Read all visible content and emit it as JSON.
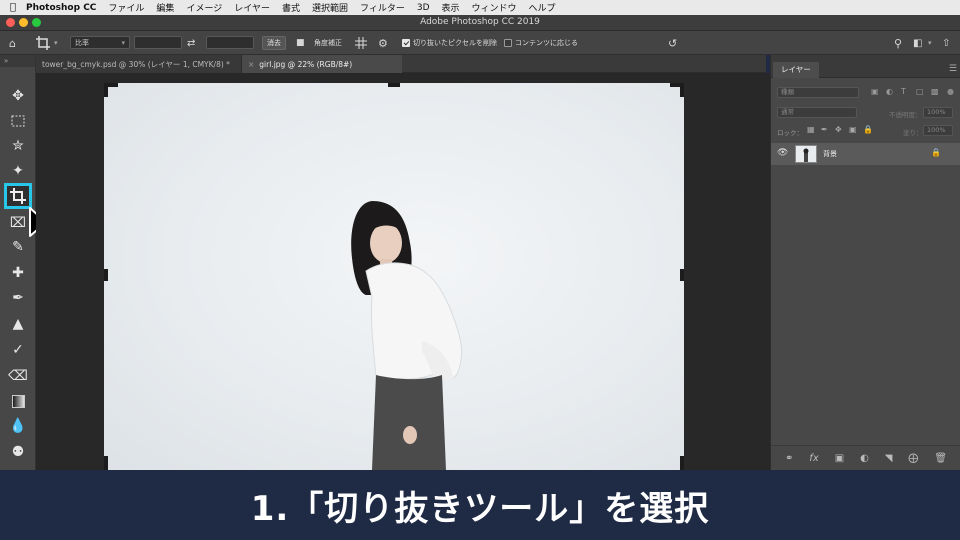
{
  "menubar": {
    "app": "Photoshop CC",
    "items": [
      "ファイル",
      "編集",
      "イメージ",
      "レイヤー",
      "書式",
      "選択範囲",
      "フィルター",
      "3D",
      "表示",
      "ウィンドウ",
      "ヘルプ"
    ]
  },
  "window": {
    "title": "Adobe Photoshop CC 2019"
  },
  "options": {
    "ratio": "比率",
    "clear": "消去",
    "straighten": "角度補正",
    "delete_cropped": "切り抜いたピクセルを削除",
    "delete_cropped_checked": true,
    "content_aware": "コンテンツに応じる",
    "content_aware_checked": false
  },
  "tabs": [
    {
      "label": "tower_bg_cmyk.psd @ 30% (レイヤー 1, CMYK/8) *",
      "active": false
    },
    {
      "label": "girl.jpg @ 22% (RGB/8#)",
      "active": true
    }
  ],
  "tools": [
    {
      "name": "move",
      "icon": "move-icon"
    },
    {
      "name": "marquee",
      "icon": "marquee-icon"
    },
    {
      "name": "lasso",
      "icon": "lasso-icon"
    },
    {
      "name": "magic-wand",
      "icon": "magic-wand-icon"
    },
    {
      "name": "crop",
      "icon": "crop-icon",
      "selected": true
    },
    {
      "name": "frame",
      "icon": "frame-icon"
    },
    {
      "name": "eyedropper",
      "icon": "eyedropper-icon"
    },
    {
      "name": "healing",
      "icon": "healing-icon"
    },
    {
      "name": "brush",
      "icon": "brush-icon"
    },
    {
      "name": "stamp",
      "icon": "stamp-icon"
    },
    {
      "name": "history-brush",
      "icon": "history-brush-icon"
    },
    {
      "name": "eraser",
      "icon": "eraser-icon"
    },
    {
      "name": "gradient",
      "icon": "gradient-icon"
    },
    {
      "name": "blur",
      "icon": "blur-icon"
    },
    {
      "name": "dodge",
      "icon": "dodge-icon"
    }
  ],
  "layers_panel": {
    "tab": "レイヤー",
    "kind": "種類",
    "blend": "通常",
    "opacity_label": "不透明度：",
    "opacity": "100%",
    "lock_label": "ロック：",
    "fill_label": "塗り：",
    "fill": "100%",
    "layers": [
      {
        "name": "背景",
        "locked": true
      }
    ]
  },
  "caption": {
    "text": "1.「切り抜きツール」を選択"
  },
  "colors": {
    "highlight": "#28c6e8",
    "banner": "#1f2a44"
  }
}
